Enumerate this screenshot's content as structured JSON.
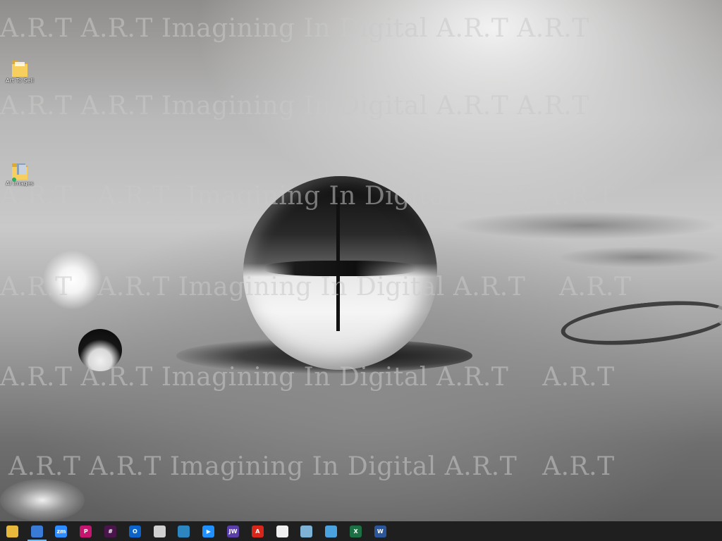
{
  "desktop": {
    "icons": [
      {
        "label": "Art To Sell"
      },
      {
        "label": "AI Images"
      }
    ]
  },
  "watermarks": [
    "A.R.T A.R.T Imagining In Digital A.R.T A.R.T",
    "A.R.T A.R.T Imagining In Digital A.R.T A.R.T",
    "A.R.T   A.R.T  Imagining In Digital A.R.T A.R.T",
    "A.R.T   A.R.T Imagining In Digital A.R.T    A.R.T",
    "A.R.T A.R.T Imagining In Digital A.R.T    A.R.T",
    " A.R.T A.R.T Imagining In Digital A.R.T   A.R.T"
  ],
  "taskbar": {
    "items": [
      {
        "icon": "file-explorer-icon",
        "glyph": "",
        "color": "#e8b83c"
      },
      {
        "icon": "microsoft-365-icon",
        "glyph": "",
        "color": "#3a7bd5"
      },
      {
        "icon": "zoom-icon",
        "glyph": "zm",
        "color": "#2d8cff"
      },
      {
        "icon": "picsart-icon",
        "glyph": "P",
        "color": "#c4166f"
      },
      {
        "icon": "slack-icon",
        "glyph": "#",
        "color": "#4a154b"
      },
      {
        "icon": "outlook-icon",
        "glyph": "O",
        "color": "#0a64c9"
      },
      {
        "icon": "file-manager-icon",
        "glyph": "",
        "color": "#d0d0d0"
      },
      {
        "icon": "canvas-app-icon",
        "glyph": "",
        "color": "#2e86c1"
      },
      {
        "icon": "media-player-icon",
        "glyph": "▶",
        "color": "#1e90ff"
      },
      {
        "icon": "jw-app-icon",
        "glyph": "JW",
        "color": "#5b3fa8"
      },
      {
        "icon": "acrobat-icon",
        "glyph": "A",
        "color": "#d8261b"
      },
      {
        "icon": "calendar-app-icon",
        "glyph": "",
        "color": "#f0f0f0"
      },
      {
        "icon": "network-app-icon",
        "glyph": "",
        "color": "#7fb3d5"
      },
      {
        "icon": "notepad-icon",
        "glyph": "",
        "color": "#4aa3df"
      },
      {
        "icon": "excel-icon",
        "glyph": "X",
        "color": "#1d7044"
      },
      {
        "icon": "word-icon",
        "glyph": "W",
        "color": "#2b579a"
      }
    ]
  }
}
